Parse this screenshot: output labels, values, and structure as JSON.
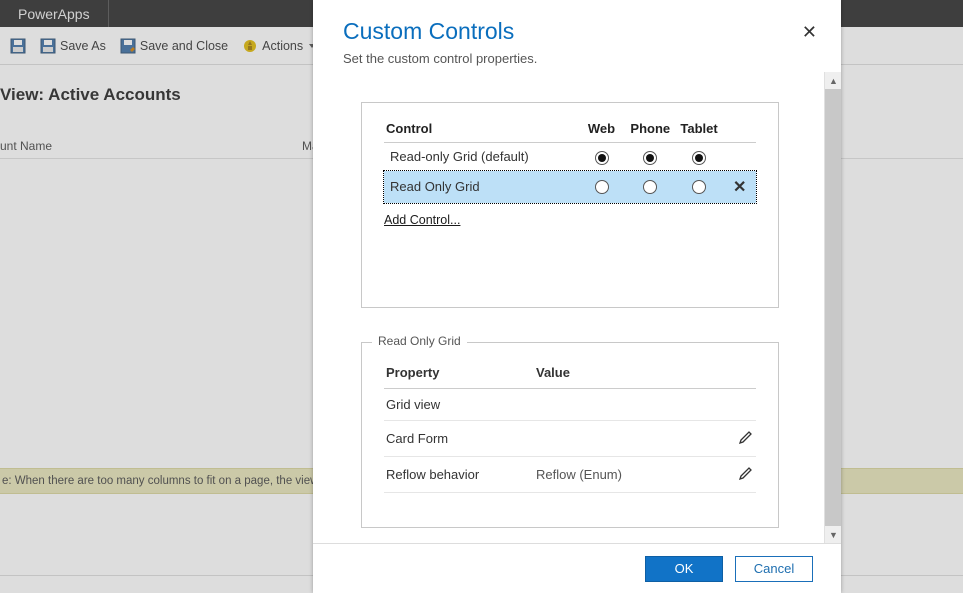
{
  "app": {
    "name": "PowerApps"
  },
  "toolbar": {
    "save_as": "Save As",
    "save_close": "Save and Close",
    "actions": "Actions"
  },
  "view": {
    "title": "View: Active Accounts",
    "columns": {
      "name": "unt Name",
      "main": "Main"
    }
  },
  "note": "e: When there are too many columns to fit on a page, the view w",
  "modal": {
    "title": "Custom Controls",
    "subtitle": "Set the custom control properties.",
    "controls": {
      "headers": {
        "control": "Control",
        "web": "Web",
        "phone": "Phone",
        "tablet": "Tablet"
      },
      "rows": [
        {
          "label": "Read-only Grid (default)",
          "web": true,
          "phone": true,
          "tablet": true,
          "removable": false,
          "selected": false
        },
        {
          "label": "Read Only Grid",
          "web": false,
          "phone": false,
          "tablet": false,
          "removable": true,
          "selected": true
        }
      ],
      "add_control": "Add Control..."
    },
    "properties": {
      "legend": "Read Only Grid",
      "headers": {
        "property": "Property",
        "value": "Value"
      },
      "rows": [
        {
          "property": "Grid view",
          "value": "",
          "editable": false
        },
        {
          "property": "Card Form",
          "value": "",
          "editable": true
        },
        {
          "property": "Reflow behavior",
          "value": "Reflow (Enum)",
          "editable": true
        }
      ]
    },
    "buttons": {
      "ok": "OK",
      "cancel": "Cancel"
    }
  }
}
